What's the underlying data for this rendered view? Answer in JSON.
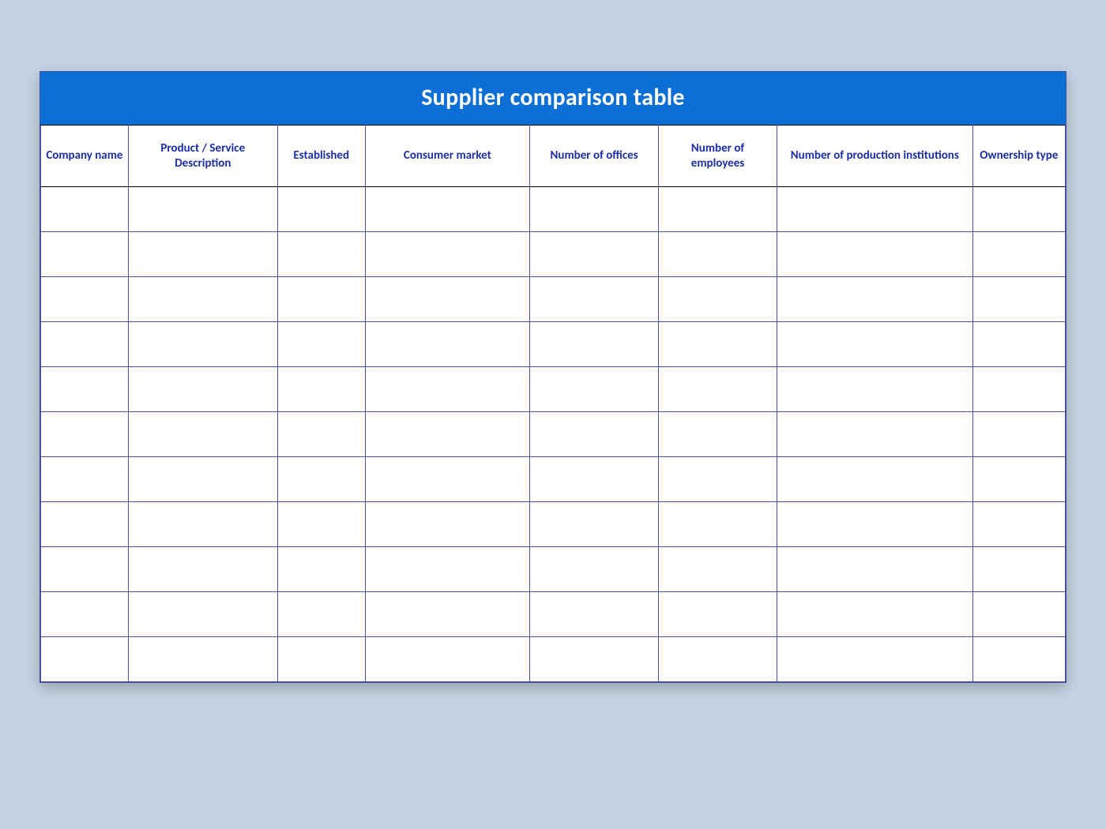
{
  "title": "Supplier comparison table",
  "columns": [
    "Company name",
    "Product / Service Description",
    "Established",
    "Consumer market",
    "Number of offices",
    "Number of employees",
    "Number of production institutions",
    "Ownership type"
  ],
  "rows": [
    {
      "company_name": "",
      "product_service_description": "",
      "established": "",
      "consumer_market": "",
      "number_of_offices": "",
      "number_of_employees": "",
      "number_of_production_institutions": "",
      "ownership_type": ""
    },
    {
      "company_name": "",
      "product_service_description": "",
      "established": "",
      "consumer_market": "",
      "number_of_offices": "",
      "number_of_employees": "",
      "number_of_production_institutions": "",
      "ownership_type": ""
    },
    {
      "company_name": "",
      "product_service_description": "",
      "established": "",
      "consumer_market": "",
      "number_of_offices": "",
      "number_of_employees": "",
      "number_of_production_institutions": "",
      "ownership_type": ""
    },
    {
      "company_name": "",
      "product_service_description": "",
      "established": "",
      "consumer_market": "",
      "number_of_offices": "",
      "number_of_employees": "",
      "number_of_production_institutions": "",
      "ownership_type": ""
    },
    {
      "company_name": "",
      "product_service_description": "",
      "established": "",
      "consumer_market": "",
      "number_of_offices": "",
      "number_of_employees": "",
      "number_of_production_institutions": "",
      "ownership_type": ""
    },
    {
      "company_name": "",
      "product_service_description": "",
      "established": "",
      "consumer_market": "",
      "number_of_offices": "",
      "number_of_employees": "",
      "number_of_production_institutions": "",
      "ownership_type": ""
    },
    {
      "company_name": "",
      "product_service_description": "",
      "established": "",
      "consumer_market": "",
      "number_of_offices": "",
      "number_of_employees": "",
      "number_of_production_institutions": "",
      "ownership_type": ""
    },
    {
      "company_name": "",
      "product_service_description": "",
      "established": "",
      "consumer_market": "",
      "number_of_offices": "",
      "number_of_employees": "",
      "number_of_production_institutions": "",
      "ownership_type": ""
    },
    {
      "company_name": "",
      "product_service_description": "",
      "established": "",
      "consumer_market": "",
      "number_of_offices": "",
      "number_of_employees": "",
      "number_of_production_institutions": "",
      "ownership_type": ""
    },
    {
      "company_name": "",
      "product_service_description": "",
      "established": "",
      "consumer_market": "",
      "number_of_offices": "",
      "number_of_employees": "",
      "number_of_production_institutions": "",
      "ownership_type": ""
    },
    {
      "company_name": "",
      "product_service_description": "",
      "established": "",
      "consumer_market": "",
      "number_of_offices": "",
      "number_of_employees": "",
      "number_of_production_institutions": "",
      "ownership_type": ""
    }
  ],
  "colors": {
    "page_bg": "#c7d3e3",
    "title_bg": "#0b6fd6",
    "title_fg": "#ffffff",
    "header_fg": "#1b2ea8",
    "grid_line": "#4a4fa8",
    "cell_bg": "#ffffff"
  }
}
